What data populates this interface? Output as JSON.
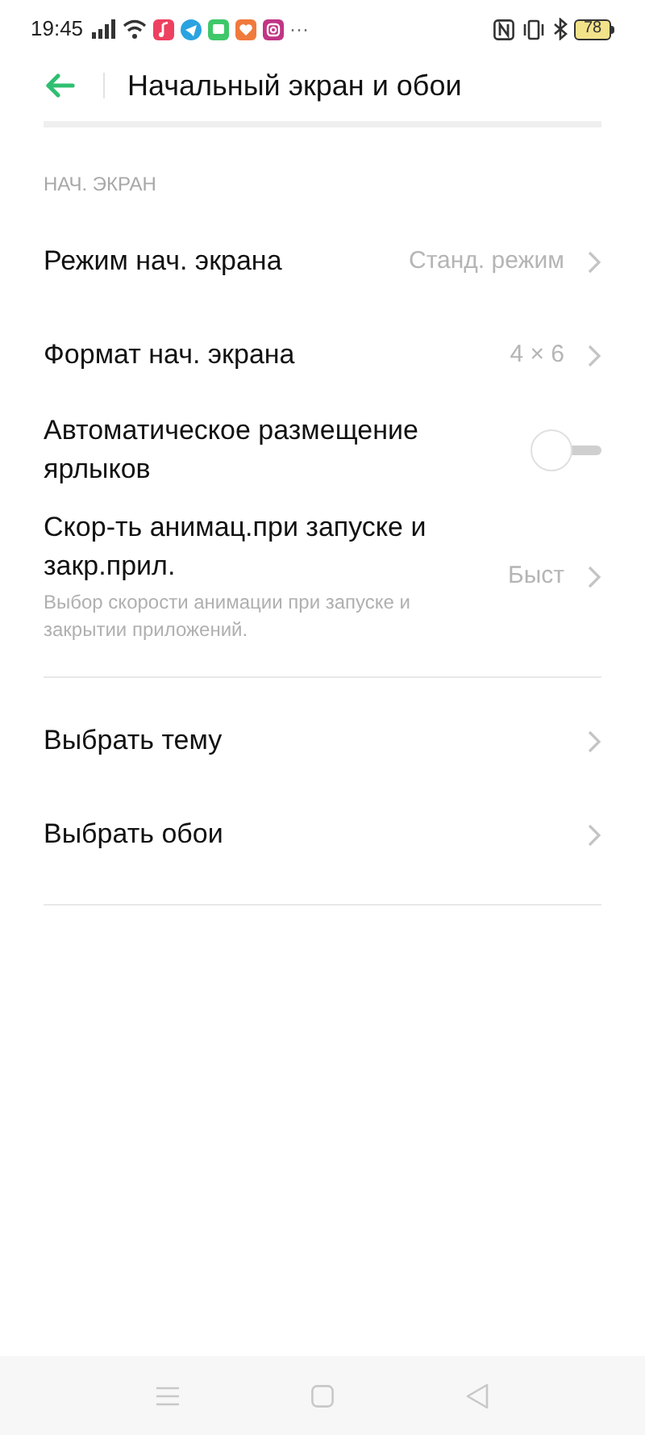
{
  "status_bar": {
    "time": "19:45",
    "more": "···",
    "battery": "78"
  },
  "header": {
    "title": "Начальный экран и обои"
  },
  "sections": [
    {
      "label": "НАЧ. ЭКРАН",
      "items": [
        {
          "kind": "link",
          "title": "Режим нач. экрана",
          "value": "Станд. режим"
        },
        {
          "kind": "link",
          "title": "Формат нач. экрана",
          "value": "4 × 6"
        },
        {
          "kind": "toggle",
          "title": "Автоматическое размещение ярлыков",
          "on": false
        },
        {
          "kind": "link",
          "title": "Скор-ть анимац.при запуске и закр.прил.",
          "value": "Быст",
          "description": "Выбор скорости анимации при запуске и закрытии приложений."
        }
      ]
    },
    {
      "items": [
        {
          "kind": "link",
          "title": "Выбрать тему"
        },
        {
          "kind": "link",
          "title": "Выбрать обои"
        }
      ]
    }
  ]
}
